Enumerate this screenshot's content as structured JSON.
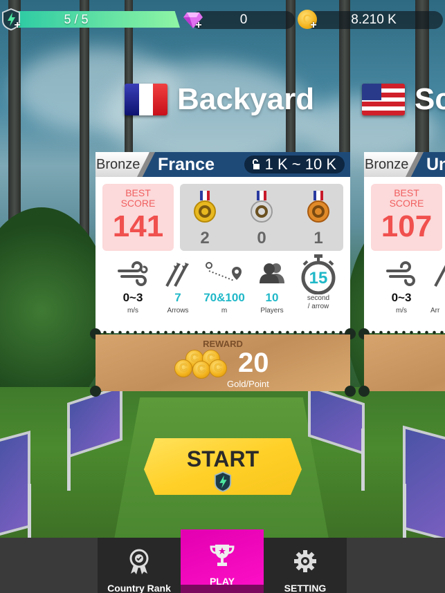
{
  "topbar": {
    "energy": "5 / 5",
    "gems": "0",
    "gold": "8.210 K"
  },
  "stages": [
    {
      "title": "Backyard",
      "flag": "france",
      "tier": "Bronze",
      "country": "France",
      "entry_range": "1 K ~ 10 K",
      "best_score_label_1": "BEST",
      "best_score_label_2": "SCORE",
      "best_score": "141",
      "medals": {
        "gold": "2",
        "silver": "0",
        "bronze": "1"
      },
      "stats": {
        "wind": {
          "value": "0~3",
          "unit": "m/s"
        },
        "arrows": {
          "value": "7",
          "unit": "Arrows"
        },
        "distance": {
          "value": "70&100",
          "unit": "m"
        },
        "players": {
          "value": "10",
          "unit": "Players"
        },
        "timer": {
          "value": "15",
          "unit_1": "second",
          "unit_2": "/ arrow"
        }
      },
      "reward_label": "REWARD",
      "reward_value": "20",
      "reward_unit": "Gold/Point"
    },
    {
      "title": "Sc",
      "flag": "usa",
      "tier": "Bronze",
      "country": "Uni",
      "best_score_label_1": "BEST",
      "best_score_label_2": "SCORE",
      "best_score": "107",
      "stats": {
        "wind": {
          "value": "0~3",
          "unit": "m/s"
        },
        "arrows_unit_partial": "Arr"
      }
    }
  ],
  "start_button": {
    "label": "START"
  },
  "nav": {
    "items": [
      {
        "label": "Country Rank",
        "icon": "ribbon-badge-icon"
      },
      {
        "label": "PLAY",
        "icon": "trophy-icon",
        "active": true
      },
      {
        "label": "SETTING",
        "icon": "gear-icon"
      }
    ]
  },
  "colors": {
    "play_active": "#ff10c8",
    "accent_teal": "#20b8c8",
    "best_score": "#f0504e",
    "header_blue": "#1e4a78",
    "start_yellow": "#ffd028"
  }
}
